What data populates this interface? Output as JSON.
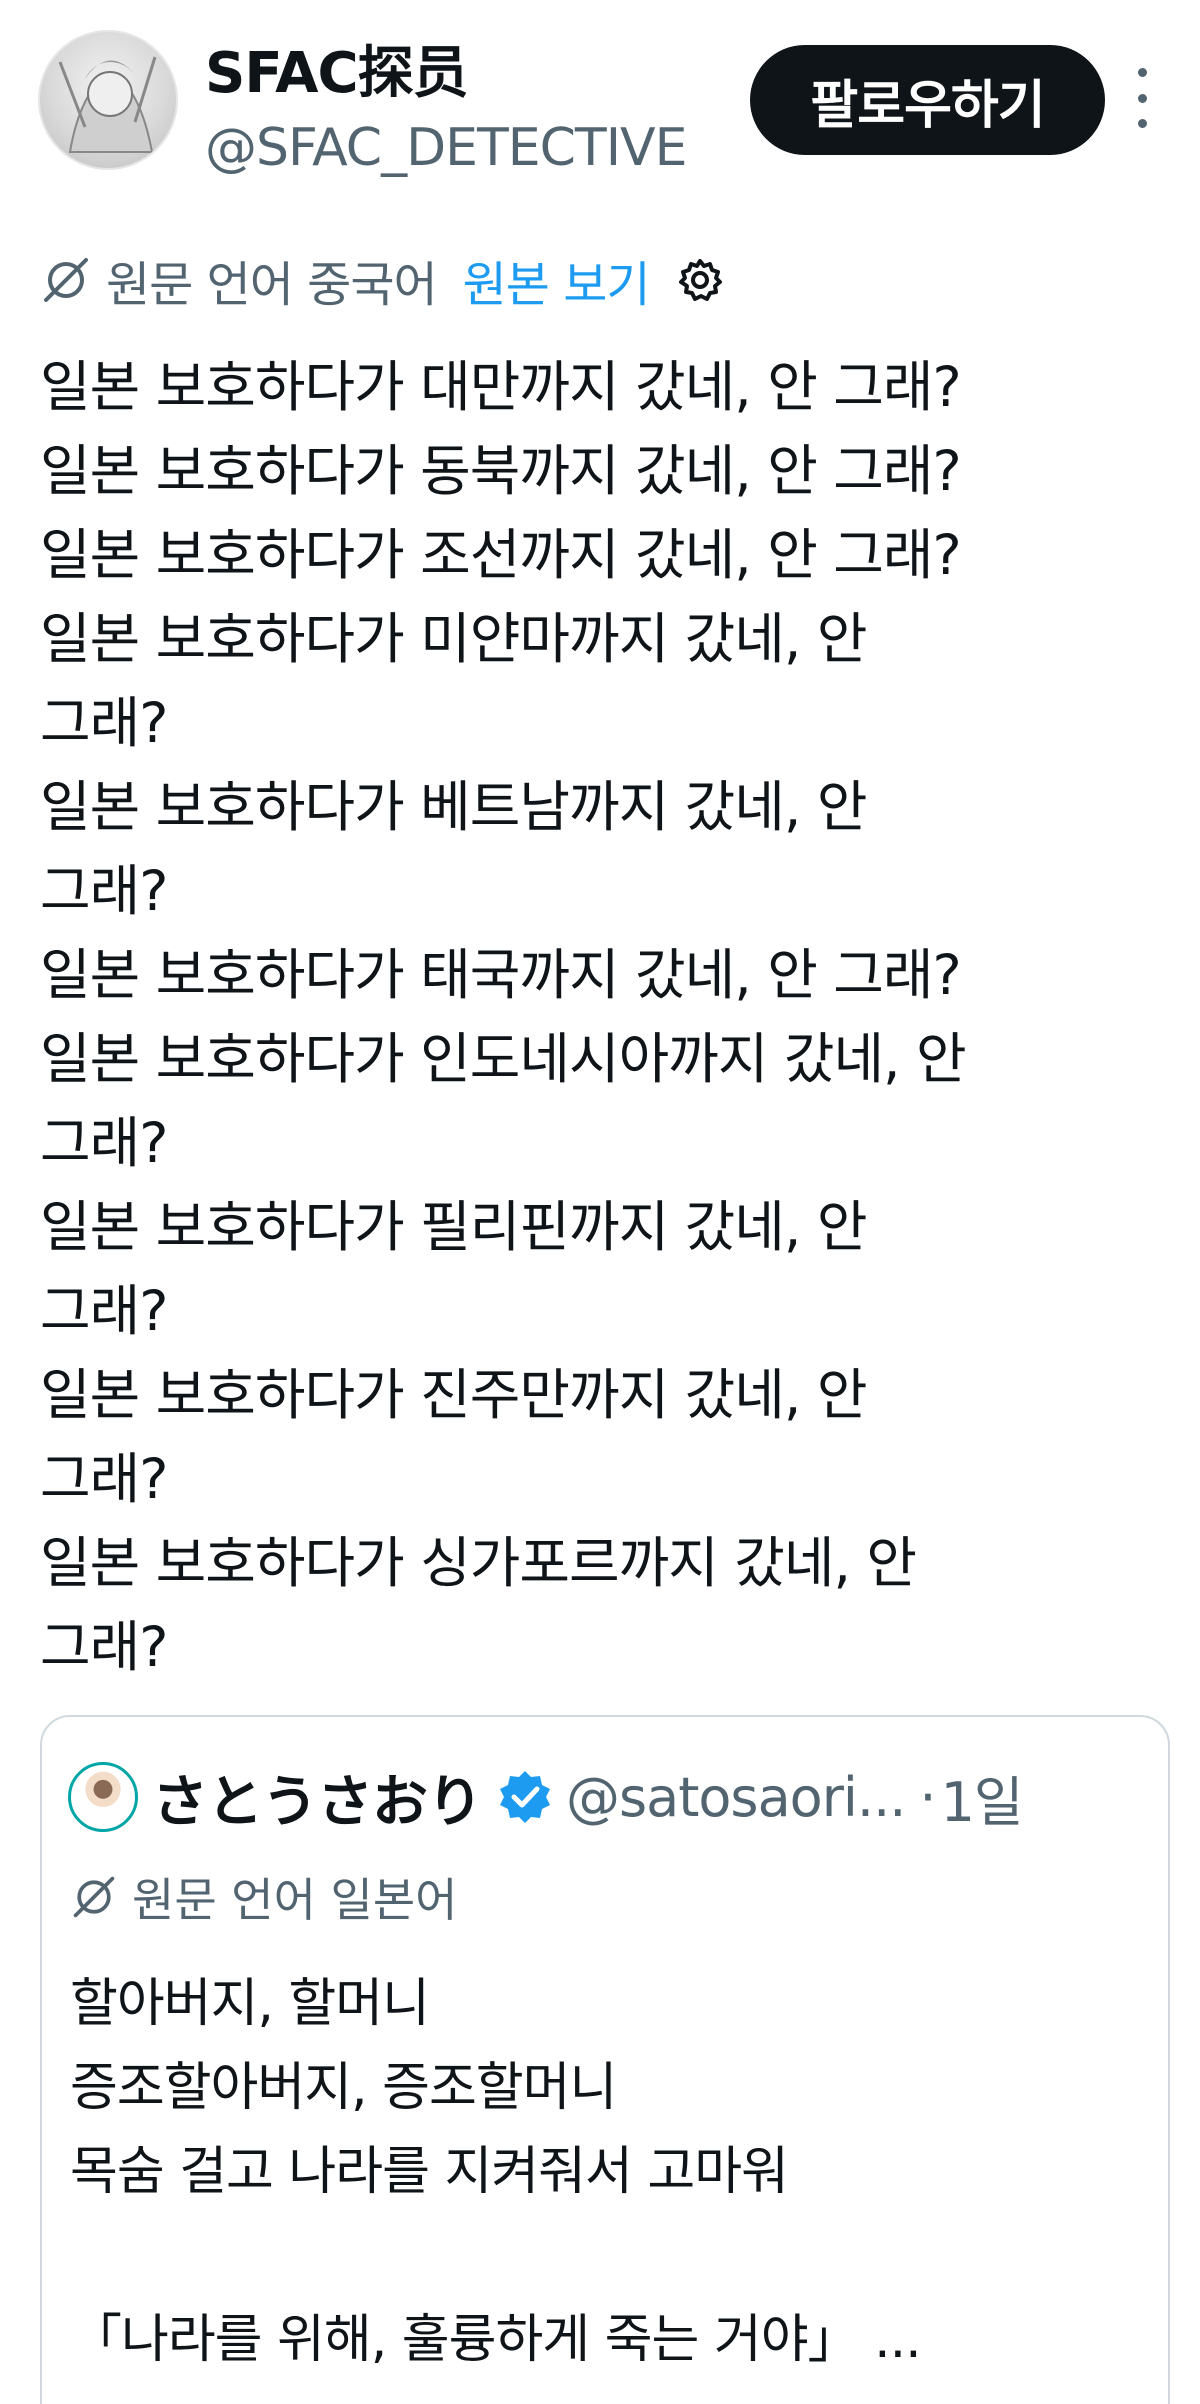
{
  "author": {
    "display_name": "SFAC探员",
    "handle": "@SFAC_DETECTIVE"
  },
  "follow_label": "팔로우하기",
  "translation": {
    "original_language": "원문 언어 중국어",
    "view_original": "원본 보기"
  },
  "tweet_lines": [
    "일본 보호하다가 대만까지 갔네, 안 그래?",
    "일본 보호하다가 동북까지 갔네, 안 그래?",
    "일본 보호하다가 조선까지 갔네, 안 그래?",
    "일본 보호하다가 미얀마까지 갔네, 안",
    "그래?",
    "일본 보호하다가 베트남까지 갔네, 안",
    "그래?",
    "일본 보호하다가 태국까지 갔네, 안 그래?",
    "일본 보호하다가 인도네시아까지 갔네, 안",
    "그래?",
    "일본 보호하다가 필리핀까지 갔네, 안",
    "그래?",
    "일본 보호하다가 진주만까지 갔네, 안",
    "그래?",
    "일본 보호하다가 싱가포르까지 갔네, 안",
    "그래?"
  ],
  "quote": {
    "display_name": "さとうさおり",
    "handle": "@satosaori...",
    "separator": "·",
    "time": "1일",
    "original_language": "원문 언어 일본어",
    "lines": [
      "할아버지, 할머니",
      "증조할아버지, 증조할머니",
      "목숨 걸고 나라를 지켜줘서 고마워",
      "",
      "「나라를 위해, 훌륭하게 죽는 거야」 ..."
    ]
  },
  "colors": {
    "text": "#0f1419",
    "secondary": "#536471",
    "link": "#1d9bf0",
    "follow_bg": "#0f1419",
    "border": "#cfd9de"
  }
}
